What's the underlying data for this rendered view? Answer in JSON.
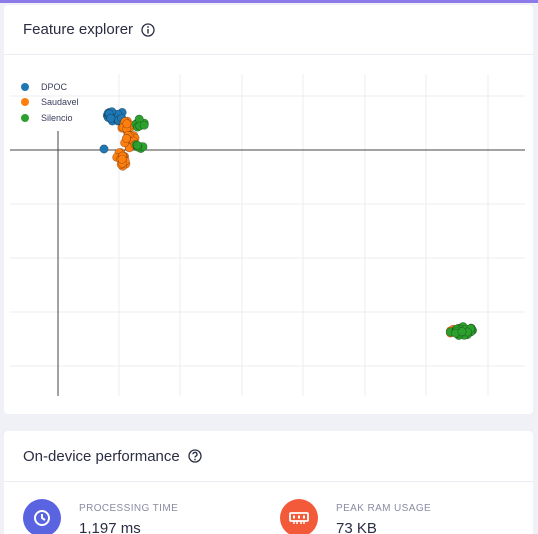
{
  "explorer": {
    "title": "Feature explorer",
    "info_icon": "info-circle-icon"
  },
  "performance": {
    "title": "On-device performance",
    "help_icon": "question-circle-icon",
    "metrics": [
      {
        "label": "PROCESSING TIME",
        "value": "1,197 ms",
        "icon": "clock-icon",
        "color": "#5a63e0"
      },
      {
        "label": "PEAK RAM USAGE",
        "value": "73 KB",
        "icon": "memory-chip-icon",
        "color": "#f25a3a"
      }
    ]
  },
  "chart_data": {
    "type": "scatter",
    "title": "",
    "xlabel": "",
    "ylabel": "",
    "grid": true,
    "legend_position": "top-left",
    "series": [
      {
        "name": "DPOC",
        "color": "#1f77b4"
      },
      {
        "name": "Saudavel",
        "color": "#ff7f0e"
      },
      {
        "name": "Silencio",
        "color": "#2ca02c"
      }
    ]
  }
}
